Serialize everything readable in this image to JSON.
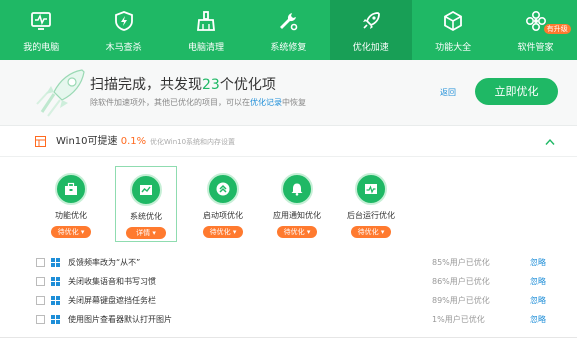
{
  "nav": {
    "items": [
      {
        "label": "我的电脑",
        "icon": "monitor-icon"
      },
      {
        "label": "木马查杀",
        "icon": "shield-bolt-icon"
      },
      {
        "label": "电脑清理",
        "icon": "broom-icon"
      },
      {
        "label": "系统修复",
        "icon": "wrench-icon"
      },
      {
        "label": "优化加速",
        "icon": "rocket-icon",
        "active": true
      },
      {
        "label": "功能大全",
        "icon": "cube-icon"
      },
      {
        "label": "软件管家",
        "icon": "flower-icon",
        "badge": "有升级"
      }
    ]
  },
  "summary": {
    "title_prefix": "扫描完成，共发现",
    "count": "23",
    "title_suffix": "个优化项",
    "sub_prefix": "除软件加速项外，其他已优化的项目，可以在",
    "sub_link": "优化记录",
    "sub_suffix": "中恢复",
    "back": "返回",
    "optimize_button": "立即优化"
  },
  "section": {
    "title": "Win10可提速",
    "percent": "0.1%",
    "note": "优化Win10系统和内存设置"
  },
  "categories": [
    {
      "label": "功能优化",
      "action": "待优化 ▾"
    },
    {
      "label": "系统优化",
      "action": "详情 ▾"
    },
    {
      "label": "启动项优化",
      "action": "待优化 ▾"
    },
    {
      "label": "应用通知优化",
      "action": "待优化 ▾"
    },
    {
      "label": "后台运行优化",
      "action": "待优化 ▾"
    }
  ],
  "items": [
    {
      "text": "反馈频率改为“从不”",
      "stat": "85%用户已优化",
      "ignore": "忽略"
    },
    {
      "text": "关闭收集语音和书写习惯",
      "stat": "86%用户已优化",
      "ignore": "忽略"
    },
    {
      "text": "关闭屏幕键盘遮挡任务栏",
      "stat": "89%用户已优化",
      "ignore": "忽略"
    },
    {
      "text": "使用图片查看器默认打开图片",
      "stat": "1%用户已优化",
      "ignore": "忽略"
    }
  ],
  "colors": {
    "brand": "#1fb865",
    "accent": "#ff7a2f",
    "link": "#1e8ed8"
  }
}
